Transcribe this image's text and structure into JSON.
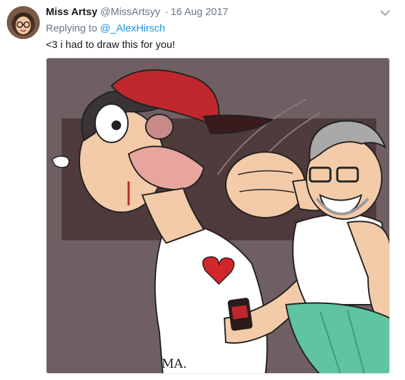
{
  "tweet": {
    "author_name": "Miss Artsy",
    "author_handle": "@MissArtsyy",
    "separator": "·",
    "date": "16 Aug 2017",
    "replying_prefix": "Replying to ",
    "replying_to": "@_AlexHirsch",
    "text": "<3 i had to draw this for you!",
    "avatar_icon": "avatar-illustration",
    "menu_icon": "chevron-down-icon",
    "media": {
      "icon": "illustration-image",
      "signature": "MA."
    }
  },
  "colors": {
    "name": "#14171a",
    "muted": "#657786",
    "link": "#1b95e0",
    "media_background": "#6f5f63",
    "media_panel": "#4f3a3c",
    "cap_red": "#c0272d",
    "shorts_green": "#5fc4a0"
  }
}
